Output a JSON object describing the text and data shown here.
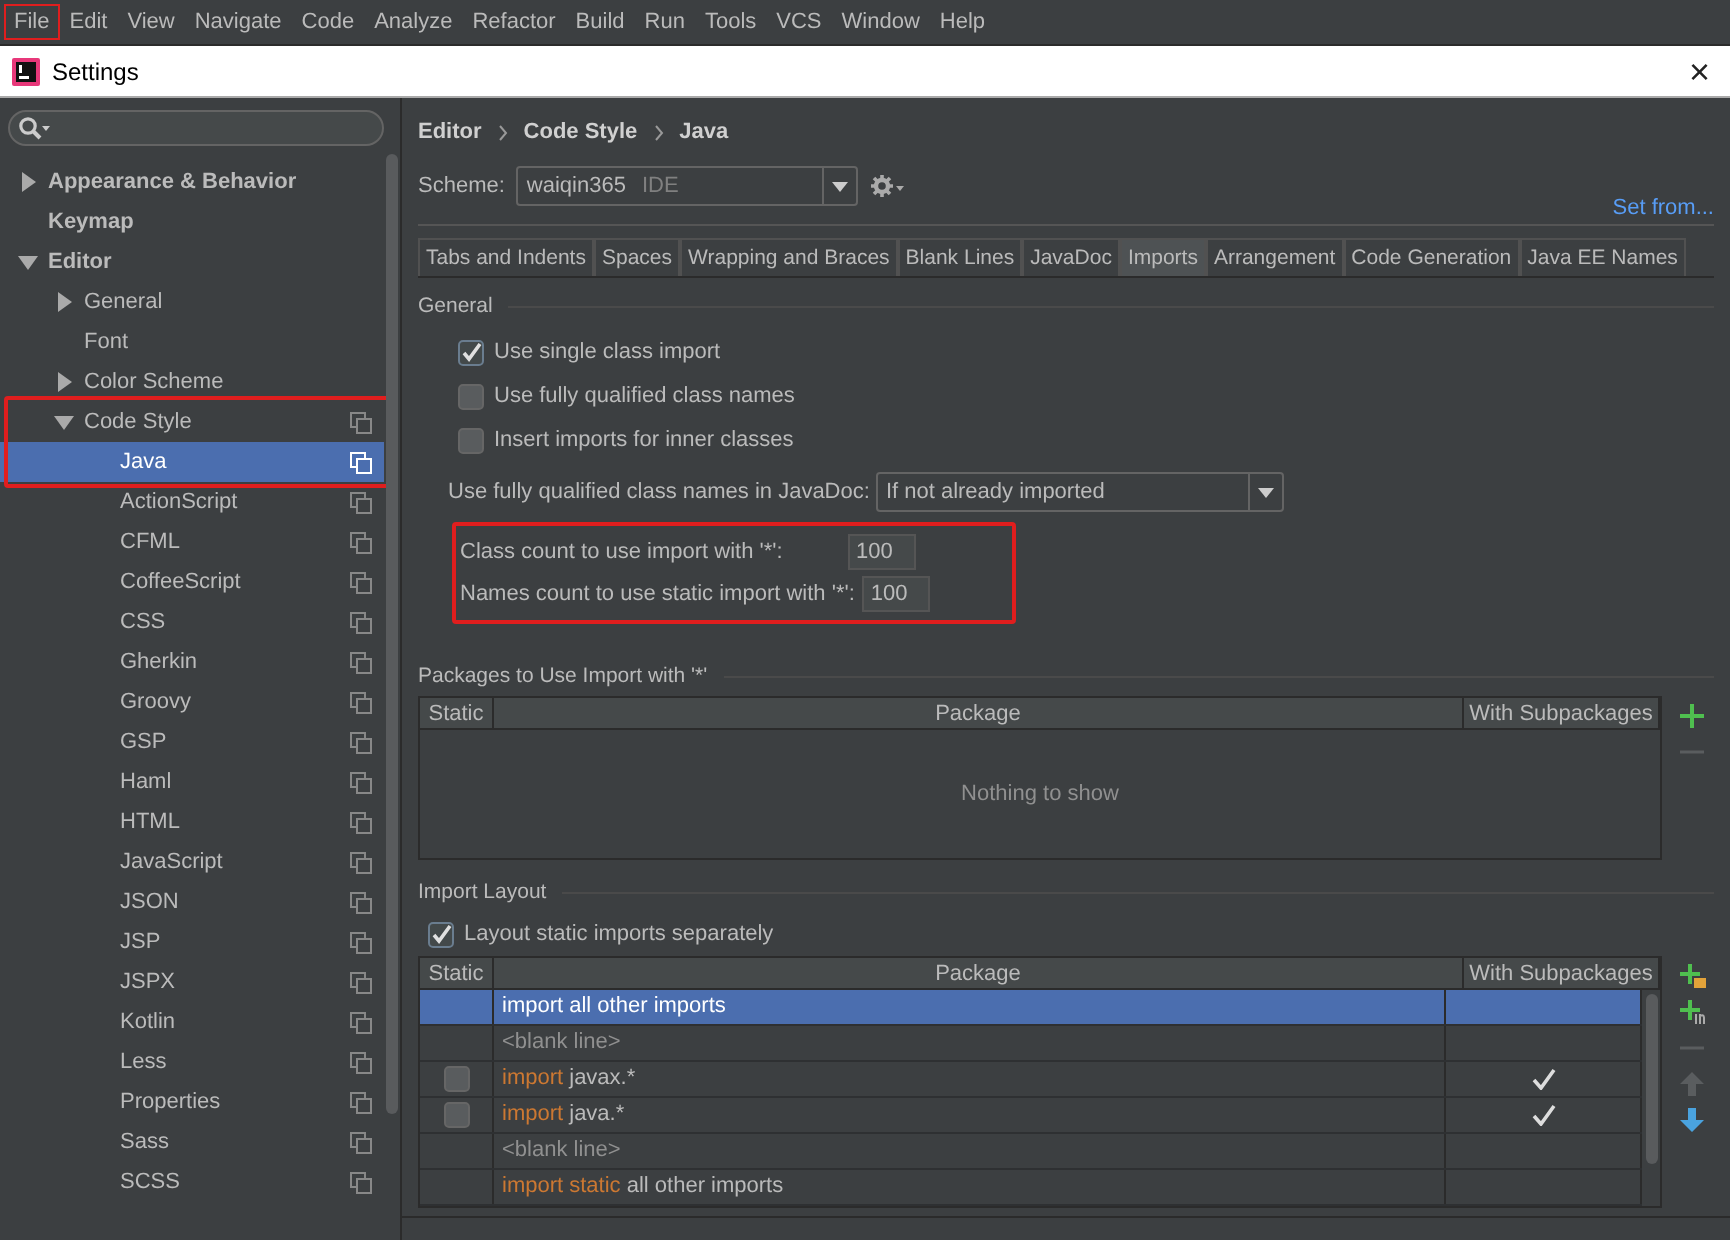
{
  "menu_bar": [
    {
      "label": "File",
      "highlighted": true
    },
    {
      "label": "Edit",
      "highlighted": false
    },
    {
      "label": "View",
      "highlighted": false
    },
    {
      "label": "Navigate",
      "highlighted": false
    },
    {
      "label": "Code",
      "highlighted": false
    },
    {
      "label": "Analyze",
      "highlighted": false
    },
    {
      "label": "Refactor",
      "highlighted": false
    },
    {
      "label": "Build",
      "highlighted": false
    },
    {
      "label": "Run",
      "highlighted": false
    },
    {
      "label": "Tools",
      "highlighted": false
    },
    {
      "label": "VCS",
      "highlighted": false
    },
    {
      "label": "Window",
      "highlighted": false
    },
    {
      "label": "Help",
      "highlighted": false
    }
  ],
  "window": {
    "title": "Settings",
    "close": "×"
  },
  "sidebar": {
    "tree": [
      {
        "label": "Appearance & Behavior",
        "expanded": false,
        "bold": true,
        "selected": false,
        "highlighted": false
      },
      {
        "label": "Keymap",
        "bold": true,
        "selected": false,
        "highlighted": false
      },
      {
        "label": "Editor",
        "expanded": true,
        "bold": true,
        "selected": false,
        "highlighted": false,
        "children": [
          {
            "label": "General",
            "expanded": false,
            "bold": false,
            "selected": false,
            "highlighted": false
          },
          {
            "label": "Font",
            "bold": false,
            "selected": false,
            "highlighted": false
          },
          {
            "label": "Color Scheme",
            "expanded": false,
            "bold": false,
            "selected": false,
            "highlighted": false
          },
          {
            "label": "Code Style",
            "expanded": true,
            "bold": false,
            "selected": false,
            "highlighted": true,
            "project_scheme": true,
            "children": [
              {
                "label": "Java",
                "bold": false,
                "selected": true,
                "highlighted": true,
                "project_scheme": true
              },
              {
                "label": "ActionScript",
                "bold": false,
                "selected": false,
                "highlighted": false,
                "project_scheme": true
              },
              {
                "label": "CFML",
                "bold": false,
                "selected": false,
                "highlighted": false,
                "project_scheme": true
              },
              {
                "label": "CoffeeScript",
                "bold": false,
                "selected": false,
                "highlighted": false,
                "project_scheme": true
              },
              {
                "label": "CSS",
                "bold": false,
                "selected": false,
                "highlighted": false,
                "project_scheme": true
              },
              {
                "label": "Gherkin",
                "bold": false,
                "selected": false,
                "highlighted": false,
                "project_scheme": true
              },
              {
                "label": "Groovy",
                "bold": false,
                "selected": false,
                "highlighted": false,
                "project_scheme": true
              },
              {
                "label": "GSP",
                "bold": false,
                "selected": false,
                "highlighted": false,
                "project_scheme": true
              },
              {
                "label": "Haml",
                "bold": false,
                "selected": false,
                "highlighted": false,
                "project_scheme": true
              },
              {
                "label": "HTML",
                "bold": false,
                "selected": false,
                "highlighted": false,
                "project_scheme": true
              },
              {
                "label": "JavaScript",
                "bold": false,
                "selected": false,
                "highlighted": false,
                "project_scheme": true
              },
              {
                "label": "JSON",
                "bold": false,
                "selected": false,
                "highlighted": false,
                "project_scheme": true
              },
              {
                "label": "JSP",
                "bold": false,
                "selected": false,
                "highlighted": false,
                "project_scheme": true
              },
              {
                "label": "JSPX",
                "bold": false,
                "selected": false,
                "highlighted": false,
                "project_scheme": true
              },
              {
                "label": "Kotlin",
                "bold": false,
                "selected": false,
                "highlighted": false,
                "project_scheme": true
              },
              {
                "label": "Less",
                "bold": false,
                "selected": false,
                "highlighted": false,
                "project_scheme": true
              },
              {
                "label": "Properties",
                "bold": false,
                "selected": false,
                "highlighted": false,
                "project_scheme": true
              },
              {
                "label": "Sass",
                "bold": false,
                "selected": false,
                "highlighted": false,
                "project_scheme": true
              },
              {
                "label": "SCSS",
                "bold": false,
                "selected": false,
                "highlighted": false,
                "project_scheme": true
              }
            ]
          }
        ]
      }
    ]
  },
  "breadcrumb": [
    "Editor",
    "Code Style",
    "Java"
  ],
  "scheme": {
    "label": "Scheme:",
    "value": "waiqin365",
    "tag": "IDE",
    "link": "Set from..."
  },
  "tabs": [
    {
      "label": "Tabs and Indents",
      "selected": false
    },
    {
      "label": "Spaces",
      "selected": false
    },
    {
      "label": "Wrapping and Braces",
      "selected": false
    },
    {
      "label": "Blank Lines",
      "selected": false
    },
    {
      "label": "JavaDoc",
      "selected": false
    },
    {
      "label": "Imports",
      "selected": true
    },
    {
      "label": "Arrangement",
      "selected": false
    },
    {
      "label": "Code Generation",
      "selected": false
    },
    {
      "label": "Java EE Names",
      "selected": false
    }
  ],
  "general": {
    "title": "General",
    "checkboxes": [
      {
        "label": "Use single class import",
        "checked": true
      },
      {
        "label": "Use fully qualified class names",
        "checked": false
      },
      {
        "label": "Insert imports for inner classes",
        "checked": false
      }
    ],
    "javadoc": {
      "label": "Use fully qualified class names in JavaDoc:",
      "value": "If not already imported"
    },
    "counts": {
      "highlighted": true,
      "fields": [
        {
          "label": "Class count to use import with '*':",
          "value": "100"
        },
        {
          "label": "Names count to use static import with '*':",
          "value": "100"
        }
      ]
    }
  },
  "packages": {
    "title": "Packages to Use Import with '*'",
    "columns": [
      "Static",
      "Package",
      "With Subpackages"
    ],
    "empty_text": "Nothing to show",
    "buttons": [
      {
        "kind": "add",
        "disabled": false
      },
      {
        "kind": "remove",
        "disabled": true
      }
    ]
  },
  "import_layout": {
    "title": "Import Layout",
    "checkbox": {
      "label": "Layout static imports separately",
      "checked": true
    },
    "columns": [
      "Static",
      "Package",
      "With Subpackages"
    ],
    "rows": [
      {
        "kind": "all_other",
        "keyword": "import",
        "text": "all other imports",
        "selected": true
      },
      {
        "kind": "blank",
        "text": "<blank line>",
        "selected": false
      },
      {
        "kind": "package",
        "keyword": "import",
        "text": "javax.*",
        "static": false,
        "with_subpackages": true,
        "selected": false
      },
      {
        "kind": "package",
        "keyword": "import",
        "text": "java.*",
        "static": false,
        "with_subpackages": true,
        "selected": false
      },
      {
        "kind": "blank",
        "text": "<blank line>",
        "selected": false
      },
      {
        "kind": "all_other",
        "keyword": "import static",
        "text": "all other imports",
        "selected": false
      }
    ],
    "buttons": [
      {
        "kind": "add_package",
        "disabled": false
      },
      {
        "kind": "add_blank",
        "disabled": false
      },
      {
        "kind": "remove",
        "disabled": true
      },
      {
        "kind": "up",
        "disabled": true
      },
      {
        "kind": "down",
        "disabled": false
      }
    ]
  }
}
